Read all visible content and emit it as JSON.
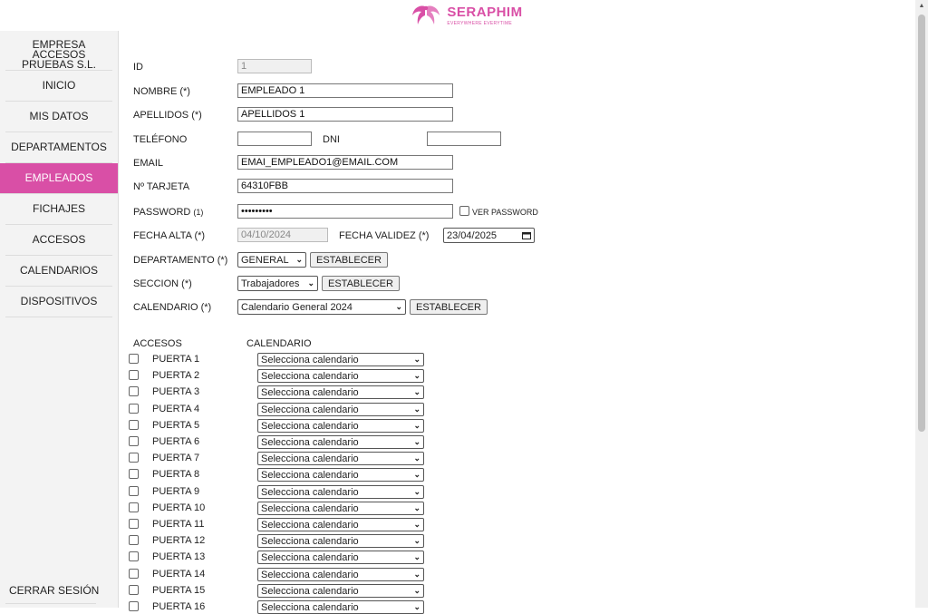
{
  "header": {
    "brand": "SERAPHIM",
    "tagline": "EVERYWHERE EVERYTIME",
    "brand_color": "#d94fa6"
  },
  "sidebar": {
    "company": "EMPRESA ACCESOS PRUEBAS S.L.",
    "items": [
      {
        "label": "INICIO"
      },
      {
        "label": "MIS DATOS"
      },
      {
        "label": "DEPARTAMENTOS"
      },
      {
        "label": "EMPLEADOS",
        "active": true
      },
      {
        "label": "FICHAJES"
      },
      {
        "label": "ACCESOS"
      },
      {
        "label": "CALENDARIOS"
      },
      {
        "label": "DISPOSITIVOS"
      }
    ],
    "logout": "CERRAR SESIÓN"
  },
  "form": {
    "id_label": "ID",
    "id_value": "1",
    "nombre_label": "NOMBRE (*)",
    "nombre_value": "EMPLEADO 1",
    "apellidos_label": "APELLIDOS (*)",
    "apellidos_value": "APELLIDOS 1",
    "telefono_label": "TELÉFONO",
    "telefono_value": "",
    "dni_label": "DNI",
    "dni_value": "",
    "email_label": "EMAIL",
    "email_value": "EMAI_EMPLEADO1@EMAIL.COM",
    "tarjeta_label": "Nº TARJETA",
    "tarjeta_value": "64310FBB",
    "password_label": "PASSWORD",
    "password_note": "(1)",
    "password_value": "•••••••••",
    "ver_password_label": "VER PASSWORD",
    "fecha_alta_label": "FECHA ALTA (*)",
    "fecha_alta_value": "04/10/2024",
    "fecha_validez_label": "FECHA VALIDEZ (*)",
    "fecha_validez_value": "23/04/2025",
    "departamento_label": "DEPARTAMENTO (*)",
    "departamento_value": "GENERAL",
    "seccion_label": "SECCION (*)",
    "seccion_value": "Trabajadores",
    "calendario_label": "CALENDARIO (*)",
    "calendario_value": "Calendario General 2024",
    "establecer": "ESTABLECER"
  },
  "accesos": {
    "col_accesos": "ACCESOS",
    "col_calendario": "CALENDARIO",
    "select_placeholder": "Selecciona calendario",
    "doors": [
      "PUERTA 1",
      "PUERTA 2",
      "PUERTA 3",
      "PUERTA 4",
      "PUERTA 5",
      "PUERTA 6",
      "PUERTA 7",
      "PUERTA 8",
      "PUERTA 9",
      "PUERTA 10",
      "PUERTA 11",
      "PUERTA 12",
      "PUERTA 13",
      "PUERTA 14",
      "PUERTA 15",
      "PUERTA 16"
    ]
  }
}
